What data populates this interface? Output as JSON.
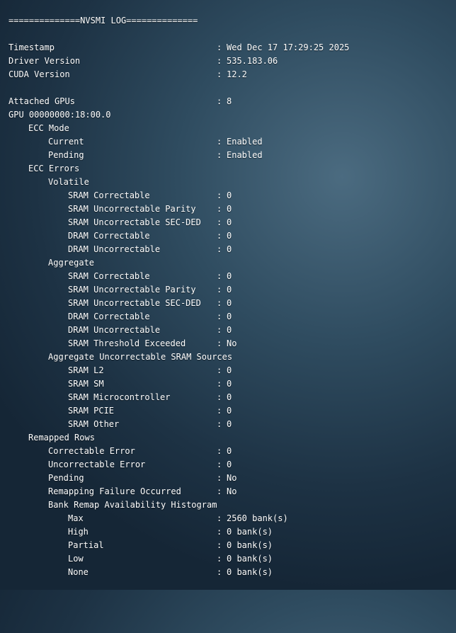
{
  "header": {
    "banner": "==============NVSMI LOG=============="
  },
  "summary": {
    "timestamp_label": "Timestamp",
    "timestamp_value": "Wed Dec 17 17:29:25 2025",
    "driver_label": "Driver Version",
    "driver_value": "535.183.06",
    "cuda_label": "CUDA Version",
    "cuda_value": "12.2",
    "attached_label": "Attached GPUs",
    "attached_value": "8",
    "gpu_id": "GPU 00000000:18:00.0"
  },
  "separator": ":",
  "ecc_mode": {
    "title": "ECC Mode",
    "current_label": "Current",
    "current_value": "Enabled",
    "pending_label": "Pending",
    "pending_value": "Enabled"
  },
  "ecc_errors": {
    "title": "ECC Errors",
    "volatile": {
      "title": "Volatile",
      "rows": [
        {
          "label": "SRAM Correctable",
          "value": "0"
        },
        {
          "label": "SRAM Uncorrectable Parity",
          "value": "0"
        },
        {
          "label": "SRAM Uncorrectable SEC-DED",
          "value": "0"
        },
        {
          "label": "DRAM Correctable",
          "value": "0"
        },
        {
          "label": "DRAM Uncorrectable",
          "value": "0"
        }
      ]
    },
    "aggregate": {
      "title": "Aggregate",
      "rows": [
        {
          "label": "SRAM Correctable",
          "value": "0"
        },
        {
          "label": "SRAM Uncorrectable Parity",
          "value": "0"
        },
        {
          "label": "SRAM Uncorrectable SEC-DED",
          "value": "0"
        },
        {
          "label": "DRAM Correctable",
          "value": "0"
        },
        {
          "label": "DRAM Uncorrectable",
          "value": "0"
        },
        {
          "label": "SRAM Threshold Exceeded",
          "value": "No"
        }
      ]
    },
    "sram_sources": {
      "title": "Aggregate Uncorrectable SRAM Sources",
      "rows": [
        {
          "label": "SRAM L2",
          "value": "0"
        },
        {
          "label": "SRAM SM",
          "value": "0"
        },
        {
          "label": "SRAM Microcontroller",
          "value": "0"
        },
        {
          "label": "SRAM PCIE",
          "value": "0"
        },
        {
          "label": "SRAM Other",
          "value": "0"
        }
      ]
    }
  },
  "remapped_rows": {
    "title": "Remapped Rows",
    "rows": [
      {
        "label": "Correctable Error",
        "value": "0"
      },
      {
        "label": "Uncorrectable Error",
        "value": "0"
      },
      {
        "label": "Pending",
        "value": "No"
      },
      {
        "label": "Remapping Failure Occurred",
        "value": "No"
      }
    ],
    "histogram": {
      "title": "Bank Remap Availability Histogram",
      "rows": [
        {
          "label": "Max",
          "value": "2560 bank(s)"
        },
        {
          "label": "High",
          "value": "0 bank(s)"
        },
        {
          "label": "Partial",
          "value": "0 bank(s)"
        },
        {
          "label": "Low",
          "value": "0 bank(s)"
        },
        {
          "label": "None",
          "value": "0 bank(s)"
        }
      ]
    }
  }
}
